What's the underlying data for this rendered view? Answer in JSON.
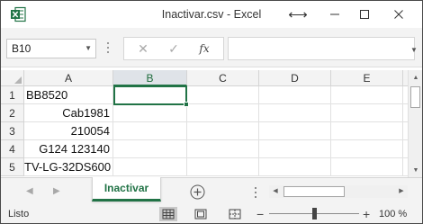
{
  "window": {
    "title": "Inactivar.csv - Excel",
    "icons": {
      "app": "excel-icon",
      "resize": "resize-arrows-icon",
      "minimize": "minimize-icon",
      "maximize": "maximize-icon",
      "close": "close-icon"
    }
  },
  "formula_bar": {
    "name_box": "B10",
    "formula": "",
    "icons": {
      "cancel": "cancel-icon",
      "enter": "check-icon",
      "insert_function": "function-icon"
    },
    "insert_function_label": "fx"
  },
  "sheet": {
    "columns": [
      "A",
      "B",
      "C",
      "D",
      "E"
    ],
    "selected_column": "B",
    "rows": [
      {
        "number": "1",
        "A": "BB8520",
        "align": "left"
      },
      {
        "number": "2",
        "A": "Cab1981",
        "align": "right"
      },
      {
        "number": "3",
        "A": "210054",
        "align": "right"
      },
      {
        "number": "4",
        "A": "G124 123140",
        "align": "right"
      },
      {
        "number": "5",
        "A": "TV-LG-32DS600",
        "align": "right"
      }
    ]
  },
  "tabs": {
    "active_sheet": "Inactivar",
    "add_icon": "add-sheet-icon"
  },
  "status_bar": {
    "status": "Listo",
    "zoom": "100 %",
    "zoom_level": 100,
    "colors": {
      "accent": "#217346"
    }
  }
}
